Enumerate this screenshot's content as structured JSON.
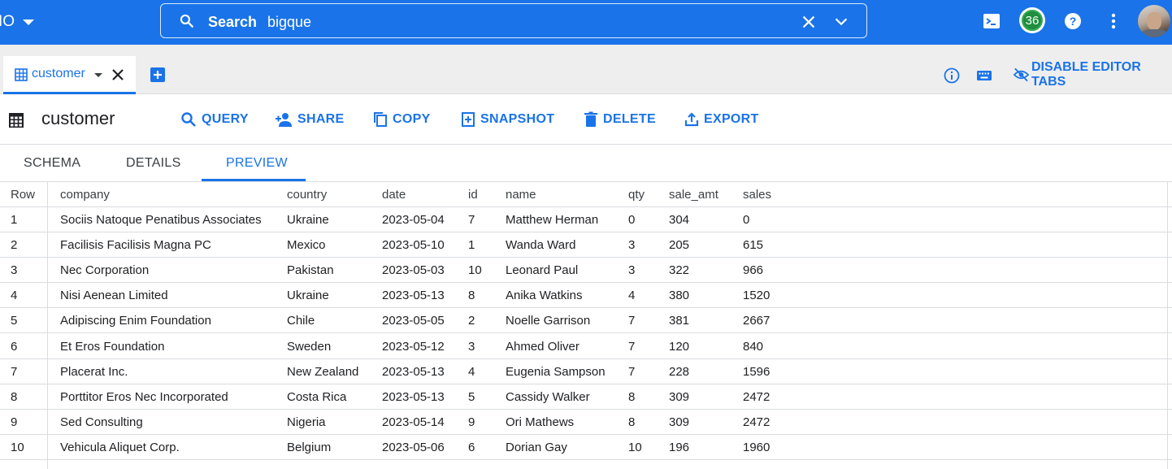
{
  "topbar": {
    "project_label": "IO",
    "search_label": "Search",
    "search_value": "bigque",
    "notification_count": "36",
    "icons": [
      "cloud-shell-icon",
      "help-icon",
      "more-vert-icon",
      "avatar"
    ]
  },
  "tabs": {
    "active_tab_label": "customer",
    "disable_label": "DISABLE EDITOR TABS"
  },
  "titlebar": {
    "title": "customer",
    "actions": {
      "query": "QUERY",
      "share": "SHARE",
      "copy": "COPY",
      "snapshot": "SNAPSHOT",
      "delete": "DELETE",
      "export": "EXPORT"
    }
  },
  "subtabs": {
    "schema": "SCHEMA",
    "details": "DETAILS",
    "preview": "PREVIEW",
    "active": "PREVIEW"
  },
  "table": {
    "headers": {
      "row": "Row",
      "company": "company",
      "country": "country",
      "date": "date",
      "id": "id",
      "name": "name",
      "qty": "qty",
      "sale_amt": "sale_amt",
      "sales": "sales"
    },
    "rows": [
      {
        "row": "1",
        "company": "Sociis Natoque Penatibus Associates",
        "country": "Ukraine",
        "date": "2023-05-04",
        "id": "7",
        "name": "Matthew Herman",
        "qty": "0",
        "sale_amt": "304",
        "sales": "0"
      },
      {
        "row": "2",
        "company": "Facilisis Facilisis Magna PC",
        "country": "Mexico",
        "date": "2023-05-10",
        "id": "1",
        "name": "Wanda Ward",
        "qty": "3",
        "sale_amt": "205",
        "sales": "615"
      },
      {
        "row": "3",
        "company": "Nec Corporation",
        "country": "Pakistan",
        "date": "2023-05-03",
        "id": "10",
        "name": "Leonard Paul",
        "qty": "3",
        "sale_amt": "322",
        "sales": "966"
      },
      {
        "row": "4",
        "company": "Nisi Aenean Limited",
        "country": "Ukraine",
        "date": "2023-05-13",
        "id": "8",
        "name": "Anika Watkins",
        "qty": "4",
        "sale_amt": "380",
        "sales": "1520"
      },
      {
        "row": "5",
        "company": "Adipiscing Enim Foundation",
        "country": "Chile",
        "date": "2023-05-05",
        "id": "2",
        "name": "Noelle Garrison",
        "qty": "7",
        "sale_amt": "381",
        "sales": "2667"
      },
      {
        "row": "6",
        "company": "Et Eros Foundation",
        "country": "Sweden",
        "date": "2023-05-12",
        "id": "3",
        "name": "Ahmed Oliver",
        "qty": "7",
        "sale_amt": "120",
        "sales": "840"
      },
      {
        "row": "7",
        "company": "Placerat Inc.",
        "country": "New Zealand",
        "date": "2023-05-13",
        "id": "4",
        "name": "Eugenia Sampson",
        "qty": "7",
        "sale_amt": "228",
        "sales": "1596"
      },
      {
        "row": "8",
        "company": "Porttitor Eros Nec Incorporated",
        "country": "Costa Rica",
        "date": "2023-05-13",
        "id": "5",
        "name": "Cassidy Walker",
        "qty": "8",
        "sale_amt": "309",
        "sales": "2472"
      },
      {
        "row": "9",
        "company": "Sed Consulting",
        "country": "Nigeria",
        "date": "2023-05-14",
        "id": "9",
        "name": "Ori Mathews",
        "qty": "8",
        "sale_amt": "309",
        "sales": "2472"
      },
      {
        "row": "10",
        "company": "Vehicula Aliquet Corp.",
        "country": "Belgium",
        "date": "2023-05-06",
        "id": "6",
        "name": "Dorian Gay",
        "qty": "10",
        "sale_amt": "196",
        "sales": "1960"
      }
    ]
  },
  "colors": {
    "brand_blue": "#1a73e8",
    "tab_strip_bg": "#eeeeee",
    "badge_green": "#1e8e3e",
    "divider": "#dadce0"
  }
}
